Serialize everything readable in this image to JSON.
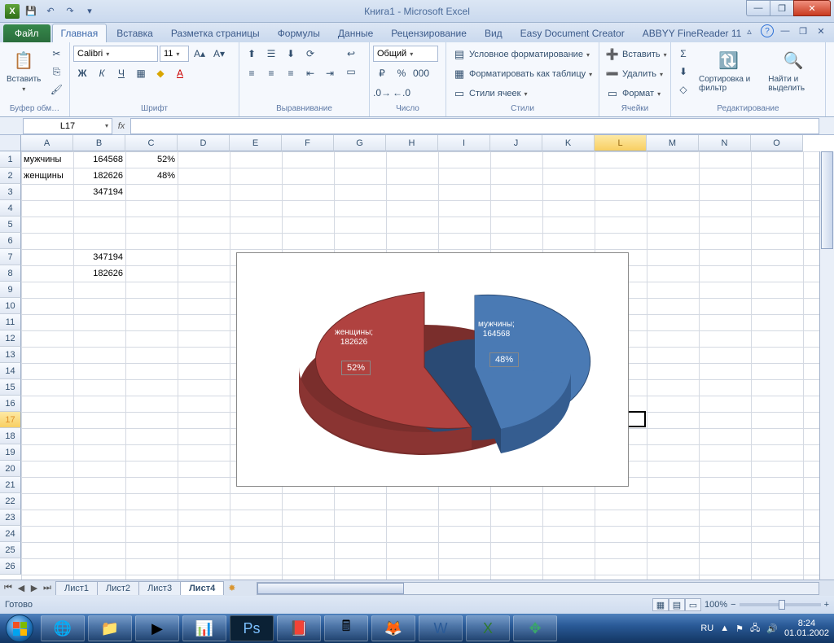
{
  "app": {
    "title": "Книга1 - Microsoft Excel"
  },
  "tabs": {
    "file": "Файл",
    "items": [
      "Главная",
      "Вставка",
      "Разметка страницы",
      "Формулы",
      "Данные",
      "Рецензирование",
      "Вид",
      "Easy Document Creator",
      "ABBYY FineReader 11"
    ],
    "active": 0
  },
  "ribbon": {
    "clipboard": {
      "label": "Буфер обм…",
      "paste": "Вставить"
    },
    "font": {
      "label": "Шрифт",
      "name": "Calibri",
      "size": "11"
    },
    "align": {
      "label": "Выравнивание"
    },
    "number": {
      "label": "Число",
      "format": "Общий"
    },
    "styles": {
      "label": "Стили",
      "cond": "Условное форматирование",
      "table": "Форматировать как таблицу",
      "cell": "Стили ячеек"
    },
    "cells": {
      "label": "Ячейки",
      "insert": "Вставить",
      "delete": "Удалить",
      "format": "Формат"
    },
    "editing": {
      "label": "Редактирование",
      "sort": "Сортировка и фильтр",
      "find": "Найти и выделить"
    }
  },
  "namebox": "L17",
  "columns": [
    "A",
    "B",
    "C",
    "D",
    "E",
    "F",
    "G",
    "H",
    "I",
    "J",
    "K",
    "L",
    "M",
    "N",
    "O"
  ],
  "cells": {
    "A1": "мужчины",
    "B1": "164568",
    "C1": "52%",
    "A2": "женщины",
    "B2": "182626",
    "C2": "48%",
    "B3": "347194",
    "B7": "347194",
    "B8": "182626"
  },
  "activeCell": "L17",
  "chart_data": {
    "type": "pie",
    "series": [
      {
        "name": "женщины",
        "value": 182626,
        "pct": 52,
        "color": "#b04240"
      },
      {
        "name": "мужчины",
        "value": 164568,
        "pct": 48,
        "color": "#4a7ab4"
      }
    ],
    "labels": {
      "women": "женщины;\n182626",
      "women_pct": "52%",
      "men": "мужчины;\n164568",
      "men_pct": "48%"
    }
  },
  "sheets": {
    "items": [
      "Лист1",
      "Лист2",
      "Лист3",
      "Лист4"
    ],
    "active": 3
  },
  "status": {
    "ready": "Готово",
    "zoom": "100%"
  },
  "taskbar": {
    "lang": "RU",
    "time": "8:24",
    "date": "01.01.2002"
  }
}
